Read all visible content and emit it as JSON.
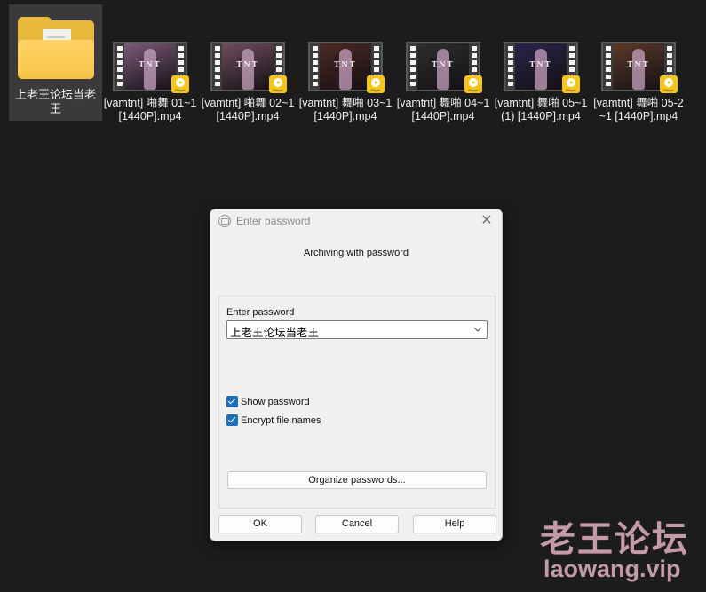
{
  "desktop": {
    "folder": {
      "name": "上老王论坛当老王",
      "icon": "folder-icon"
    },
    "files": [
      {
        "name": "[vamtnt] 啪舞 01~1 [1440P].mp4",
        "thumb_text": "TNT",
        "badge": "Player",
        "tint": "#7a5a78"
      },
      {
        "name": "[vamtnt] 啪舞 02~1 [1440P].mp4",
        "thumb_text": "TNT",
        "badge": "Player",
        "tint": "#6e4e5c"
      },
      {
        "name": "[vamtnt] 舞啪 03~1 [1440P].mp4",
        "thumb_text": "TNT",
        "badge": "Player",
        "tint": "#4a2a22"
      },
      {
        "name": "[vamtnt] 舞啪 04~1 [1440P].mp4",
        "thumb_text": "TNT",
        "badge": "Player",
        "tint": "#2e2e2e"
      },
      {
        "name": "[vamtnt] 舞啪 05~1(1) [1440P].mp4",
        "thumb_text": "TNT",
        "badge": "Player",
        "tint": "#2a2448"
      },
      {
        "name": "[vamtnt] 舞啪 05-2~1 [1440P].mp4",
        "thumb_text": "TNT",
        "badge": "Player",
        "tint": "#5a3a2a"
      }
    ]
  },
  "dialog": {
    "title": "Enter password",
    "subtitle": "Archiving with password",
    "password_label": "Enter password",
    "password_value": "上老王论坛当老王",
    "show_password": {
      "label": "Show password",
      "checked": true
    },
    "encrypt_names": {
      "label": "Encrypt file names",
      "checked": true
    },
    "organize_label": "Organize passwords...",
    "ok_label": "OK",
    "cancel_label": "Cancel",
    "help_label": "Help",
    "close_glyph": "✕"
  },
  "watermark": {
    "cn": "老王论坛",
    "en": "laowang.vip"
  },
  "colors": {
    "checkbox": "#1d6fb8",
    "watermark": "#c49aa6",
    "folder": "#f6c344",
    "badge": "#f5c518"
  }
}
